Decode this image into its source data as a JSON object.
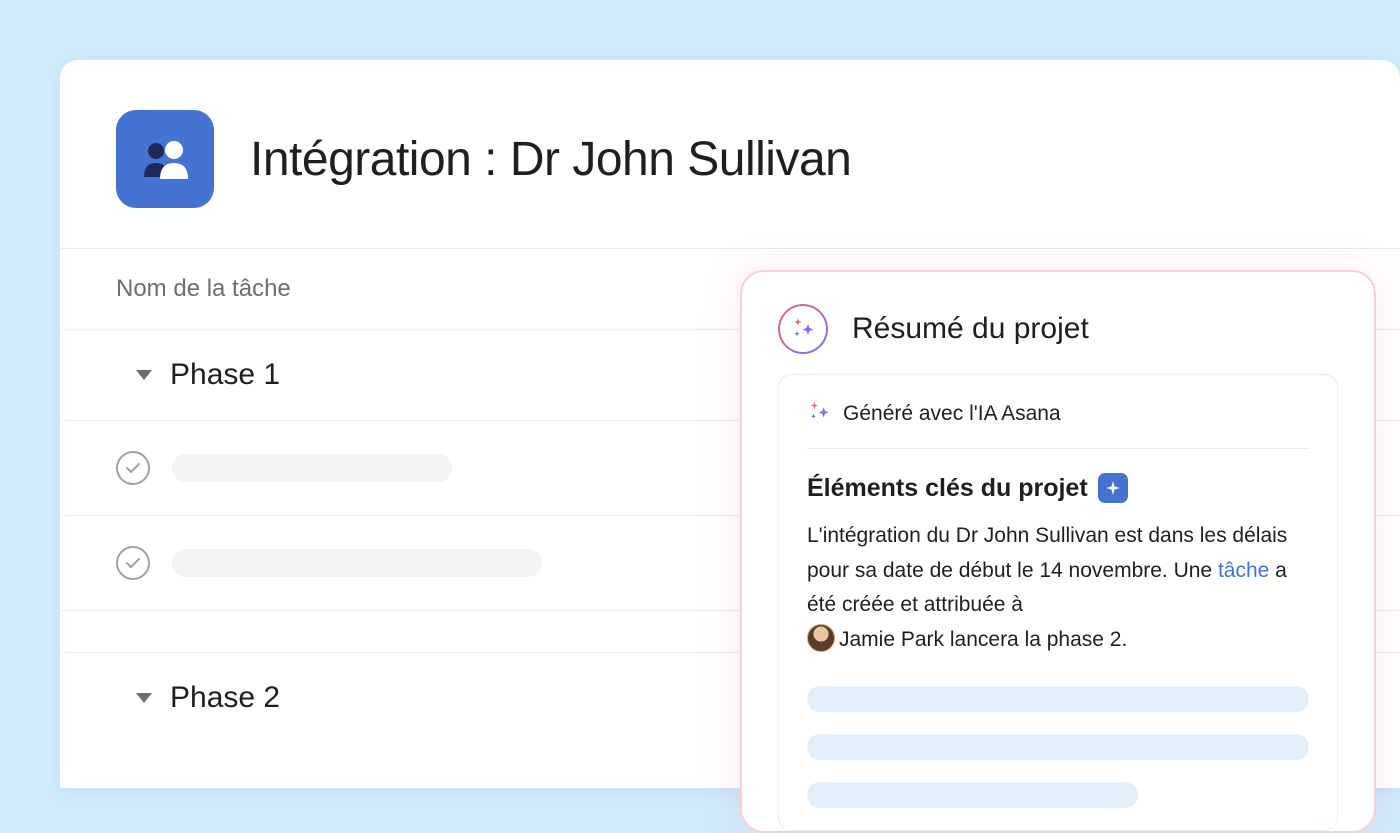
{
  "project": {
    "title": "Intégration : Dr John Sullivan",
    "column_header": "Nom de la tâche"
  },
  "sections": [
    {
      "title": "Phase 1"
    },
    {
      "title": "Phase 2"
    }
  ],
  "summary": {
    "title": "Résumé du projet",
    "generated_by": "Généré avec l'IA Asana",
    "key_heading": "Éléments clés du projet",
    "body_part1": "L'intégration du Dr John Sullivan est dans les délais pour sa date de début le 14 novembre. Une ",
    "link_text": "tâche",
    "body_part2": " a été créée et attribuée à",
    "body_part3": "Jamie Park lancera la phase 2.",
    "assignee": "Jamie Park"
  }
}
